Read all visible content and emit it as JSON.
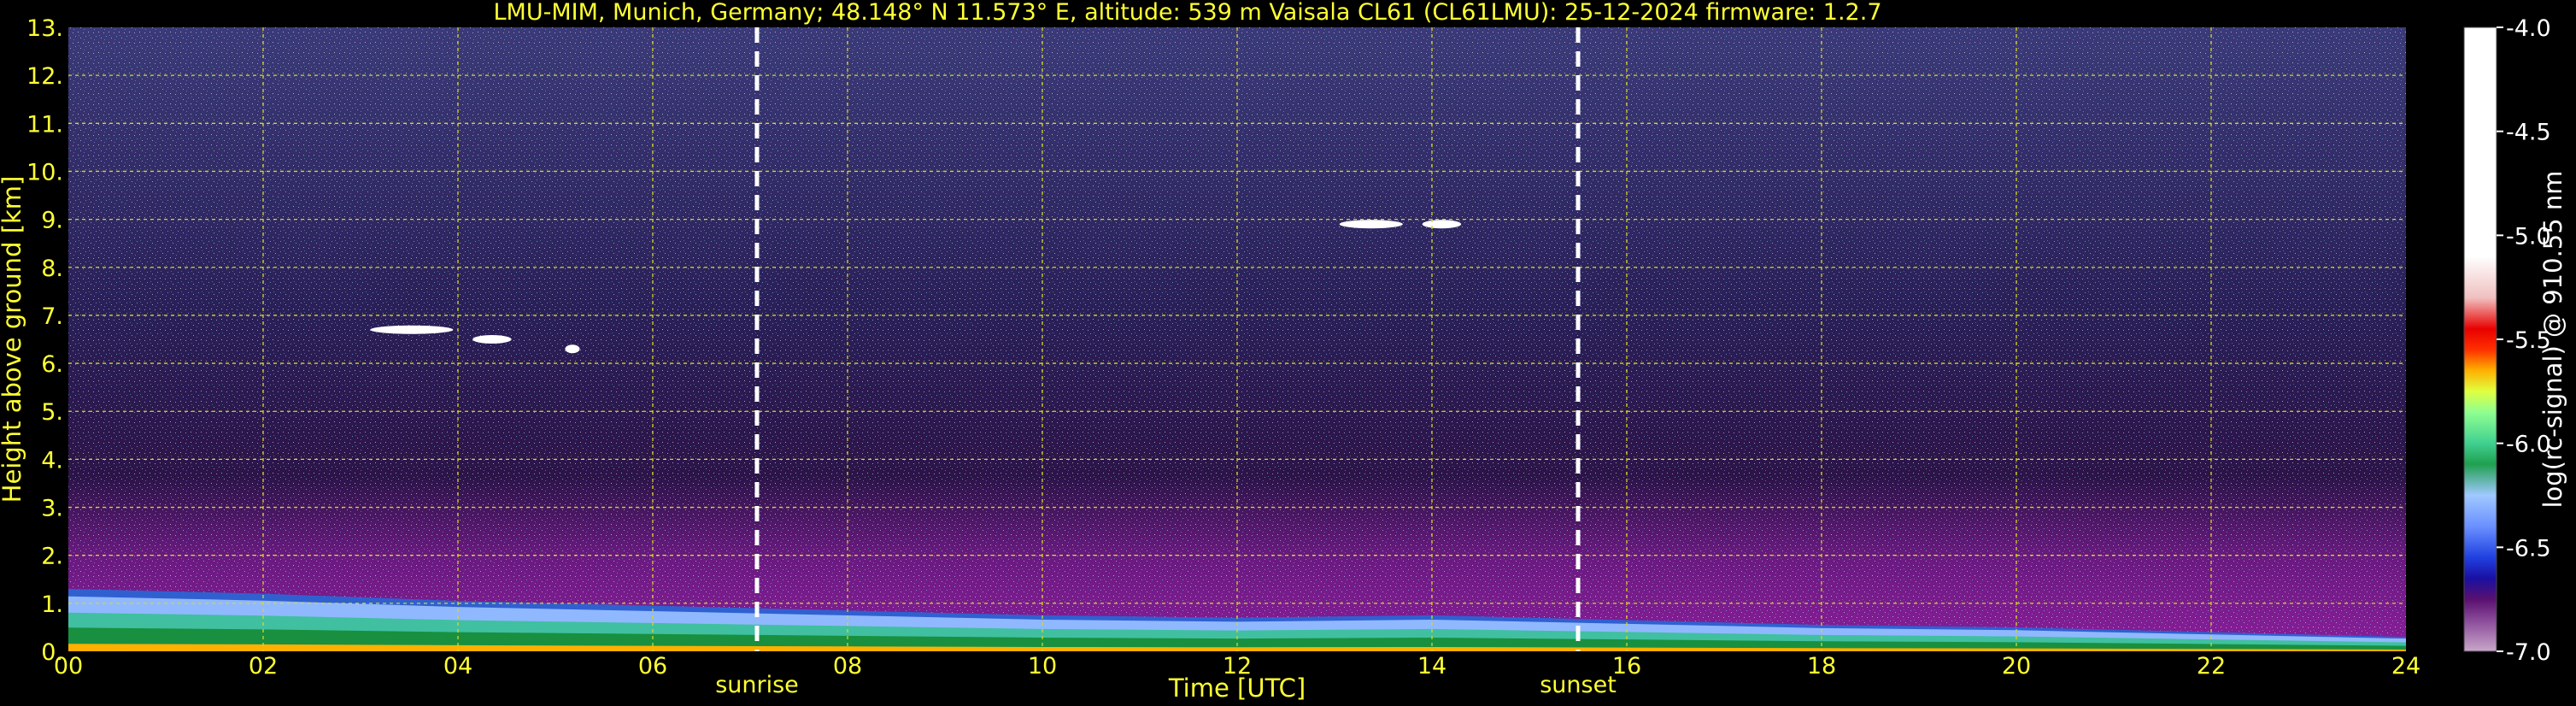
{
  "chart_data": {
    "type": "heatmap",
    "title": "LMU-MIM, Munich, Germany; 48.148° N 11.573° E, altitude: 539 m    Vaisala CL61 (CL61LMU): 25-12-2024    firmware: 1.2.7",
    "xlabel": "Time [UTC]",
    "ylabel": "Height above ground [km]",
    "xlim": [
      0,
      24
    ],
    "ylim": [
      0,
      13
    ],
    "x_ticks": [
      "00",
      "02",
      "04",
      "06",
      "08",
      "10",
      "12",
      "14",
      "16",
      "18",
      "20",
      "22",
      "24"
    ],
    "y_ticks": [
      "0.",
      "1.",
      "2.",
      "3.",
      "4.",
      "5.",
      "6.",
      "7.",
      "8.",
      "9.",
      "10.",
      "11.",
      "12.",
      "13."
    ],
    "grid": true,
    "vlines": [
      {
        "x": 7.07,
        "label": "sunrise",
        "color": "#ffffff",
        "style": "dashed"
      },
      {
        "x": 15.5,
        "label": "sunset",
        "color": "#ffffff",
        "style": "dashed"
      }
    ],
    "colorbar": {
      "label": "log(rc-signal) @ 910.55 nm",
      "range": [
        -7.0,
        -4.0
      ],
      "ticks": [
        "-4.0",
        "-4.5",
        "-5.0",
        "-5.5",
        "-6.0",
        "-6.5",
        "-7.0"
      ],
      "stops": [
        {
          "v": -7.0,
          "color": "#c9a7c9"
        },
        {
          "v": -6.85,
          "color": "#8a4a9a"
        },
        {
          "v": -6.75,
          "color": "#5a1070"
        },
        {
          "v": -6.65,
          "color": "#1a10a0"
        },
        {
          "v": -6.55,
          "color": "#2040e0"
        },
        {
          "v": -6.4,
          "color": "#6a90ff"
        },
        {
          "v": -6.25,
          "color": "#a0c8ff"
        },
        {
          "v": -6.1,
          "color": "#20a050"
        },
        {
          "v": -6.0,
          "color": "#40d090"
        },
        {
          "v": -5.85,
          "color": "#90ff90"
        },
        {
          "v": -5.75,
          "color": "#e0ff40"
        },
        {
          "v": -5.65,
          "color": "#ffb000"
        },
        {
          "v": -5.55,
          "color": "#ff3000"
        },
        {
          "v": -5.45,
          "color": "#e80000"
        },
        {
          "v": -5.3,
          "color": "#f0c0c0"
        },
        {
          "v": -5.1,
          "color": "#ffffff"
        },
        {
          "v": -4.0,
          "color": "#ffffff"
        }
      ]
    },
    "features": {
      "boundary_layer_top_km": [
        {
          "t": 0,
          "h": 1.3
        },
        {
          "t": 2,
          "h": 1.2
        },
        {
          "t": 4,
          "h": 1.05
        },
        {
          "t": 6,
          "h": 0.95
        },
        {
          "t": 8,
          "h": 0.85
        },
        {
          "t": 10,
          "h": 0.75
        },
        {
          "t": 12,
          "h": 0.7
        },
        {
          "t": 14,
          "h": 0.75
        },
        {
          "t": 16,
          "h": 0.65
        },
        {
          "t": 18,
          "h": 0.55
        },
        {
          "t": 20,
          "h": 0.5
        },
        {
          "t": 22,
          "h": 0.4
        },
        {
          "t": 24,
          "h": 0.3
        }
      ],
      "clouds": [
        {
          "t_start": 3.1,
          "t_end": 3.95,
          "h": 6.7
        },
        {
          "t_start": 4.15,
          "t_end": 4.55,
          "h": 6.5
        },
        {
          "t_start": 5.1,
          "t_end": 5.25,
          "h": 6.3
        },
        {
          "t_start": 13.05,
          "t_end": 13.7,
          "h": 8.9
        },
        {
          "t_start": 13.9,
          "t_end": 14.3,
          "h": 8.9
        }
      ]
    }
  }
}
